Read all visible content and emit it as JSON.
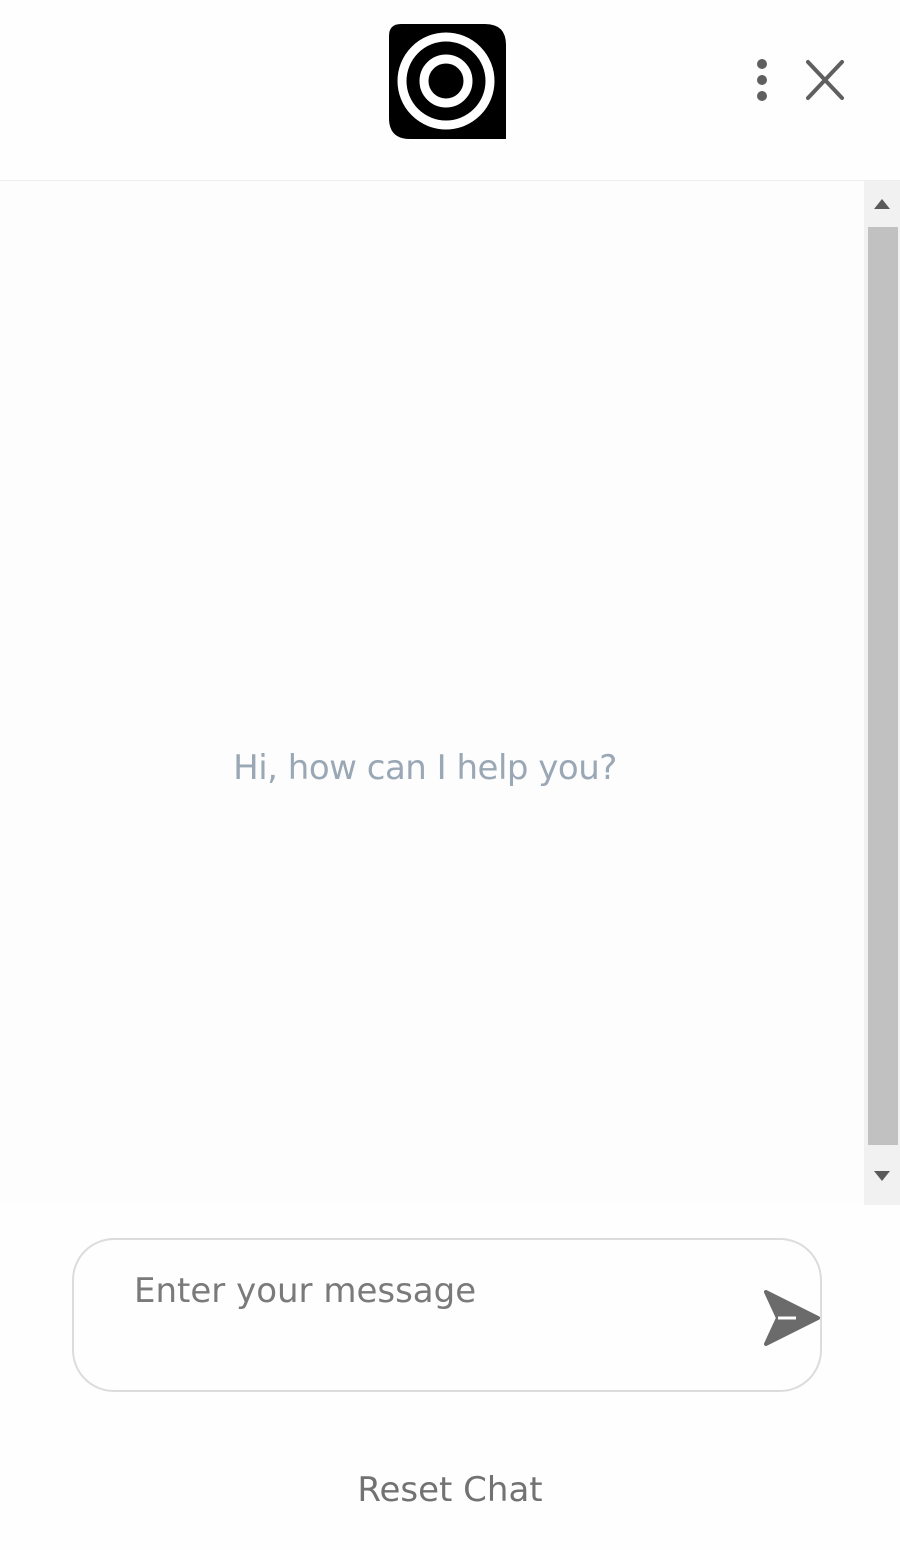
{
  "header": {
    "logo_icon": "target-logo-icon",
    "more_icon": "more-vertical-icon",
    "close_icon": "close-icon"
  },
  "chat": {
    "greeting": "Hi, how can I help you?"
  },
  "composer": {
    "placeholder": "Enter your message",
    "value": "",
    "send_icon": "send-icon"
  },
  "footer": {
    "reset_label": "Reset Chat"
  },
  "colors": {
    "greeting_text": "#9aa7b5",
    "icon_gray": "#5f5f5f",
    "logo_black": "#000000",
    "scroll_thumb": "#c1c1c1",
    "scroll_track": "#f1f1f1"
  }
}
